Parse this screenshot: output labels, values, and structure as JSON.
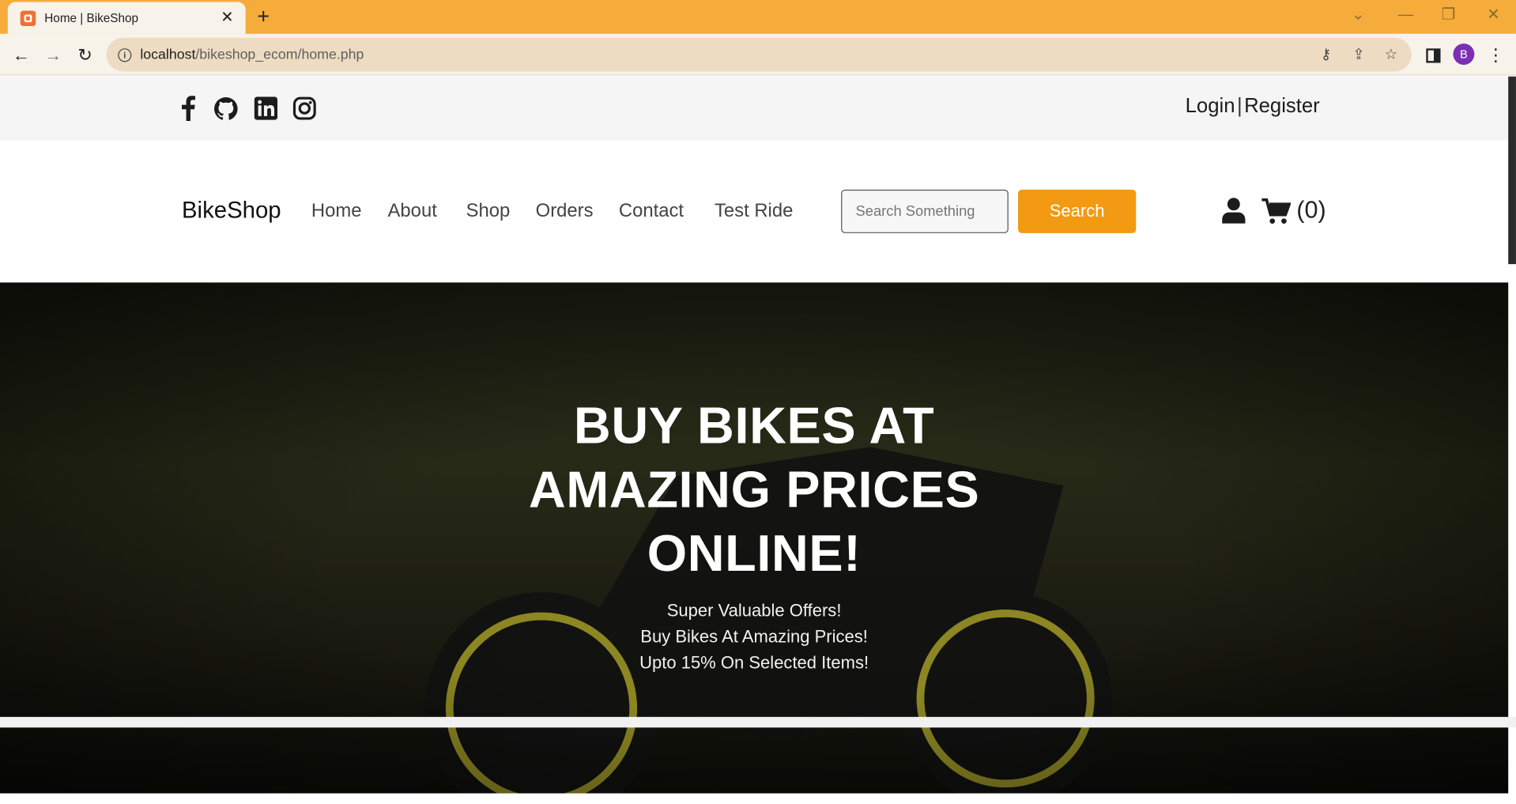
{
  "browser": {
    "tab_title": "Home | BikeShop",
    "url_host": "localhost",
    "url_path": "/bikeshop_ecom/home.php",
    "profile_initial": "B",
    "accent_color": "#f5ac3b"
  },
  "topbar": {
    "social_icons": [
      "facebook-icon",
      "github-icon",
      "linkedin-icon",
      "instagram-icon"
    ],
    "login_label": "Login",
    "separator": "|",
    "register_label": "Register"
  },
  "navbar": {
    "brand": "BikeShop",
    "links": [
      "Home",
      "About",
      "Shop",
      "Orders",
      "Contact",
      "Test Ride"
    ],
    "search_placeholder": "Search Something",
    "search_button": "Search",
    "cart_count": "(0)",
    "button_color": "#f29a11"
  },
  "hero": {
    "title": "BUY BIKES AT AMAZING PRICES ONLINE!",
    "lines": [
      "Super Valuable Offers!",
      "Buy Bikes At Amazing Prices!",
      "Upto 15% On Selected Items!"
    ]
  }
}
